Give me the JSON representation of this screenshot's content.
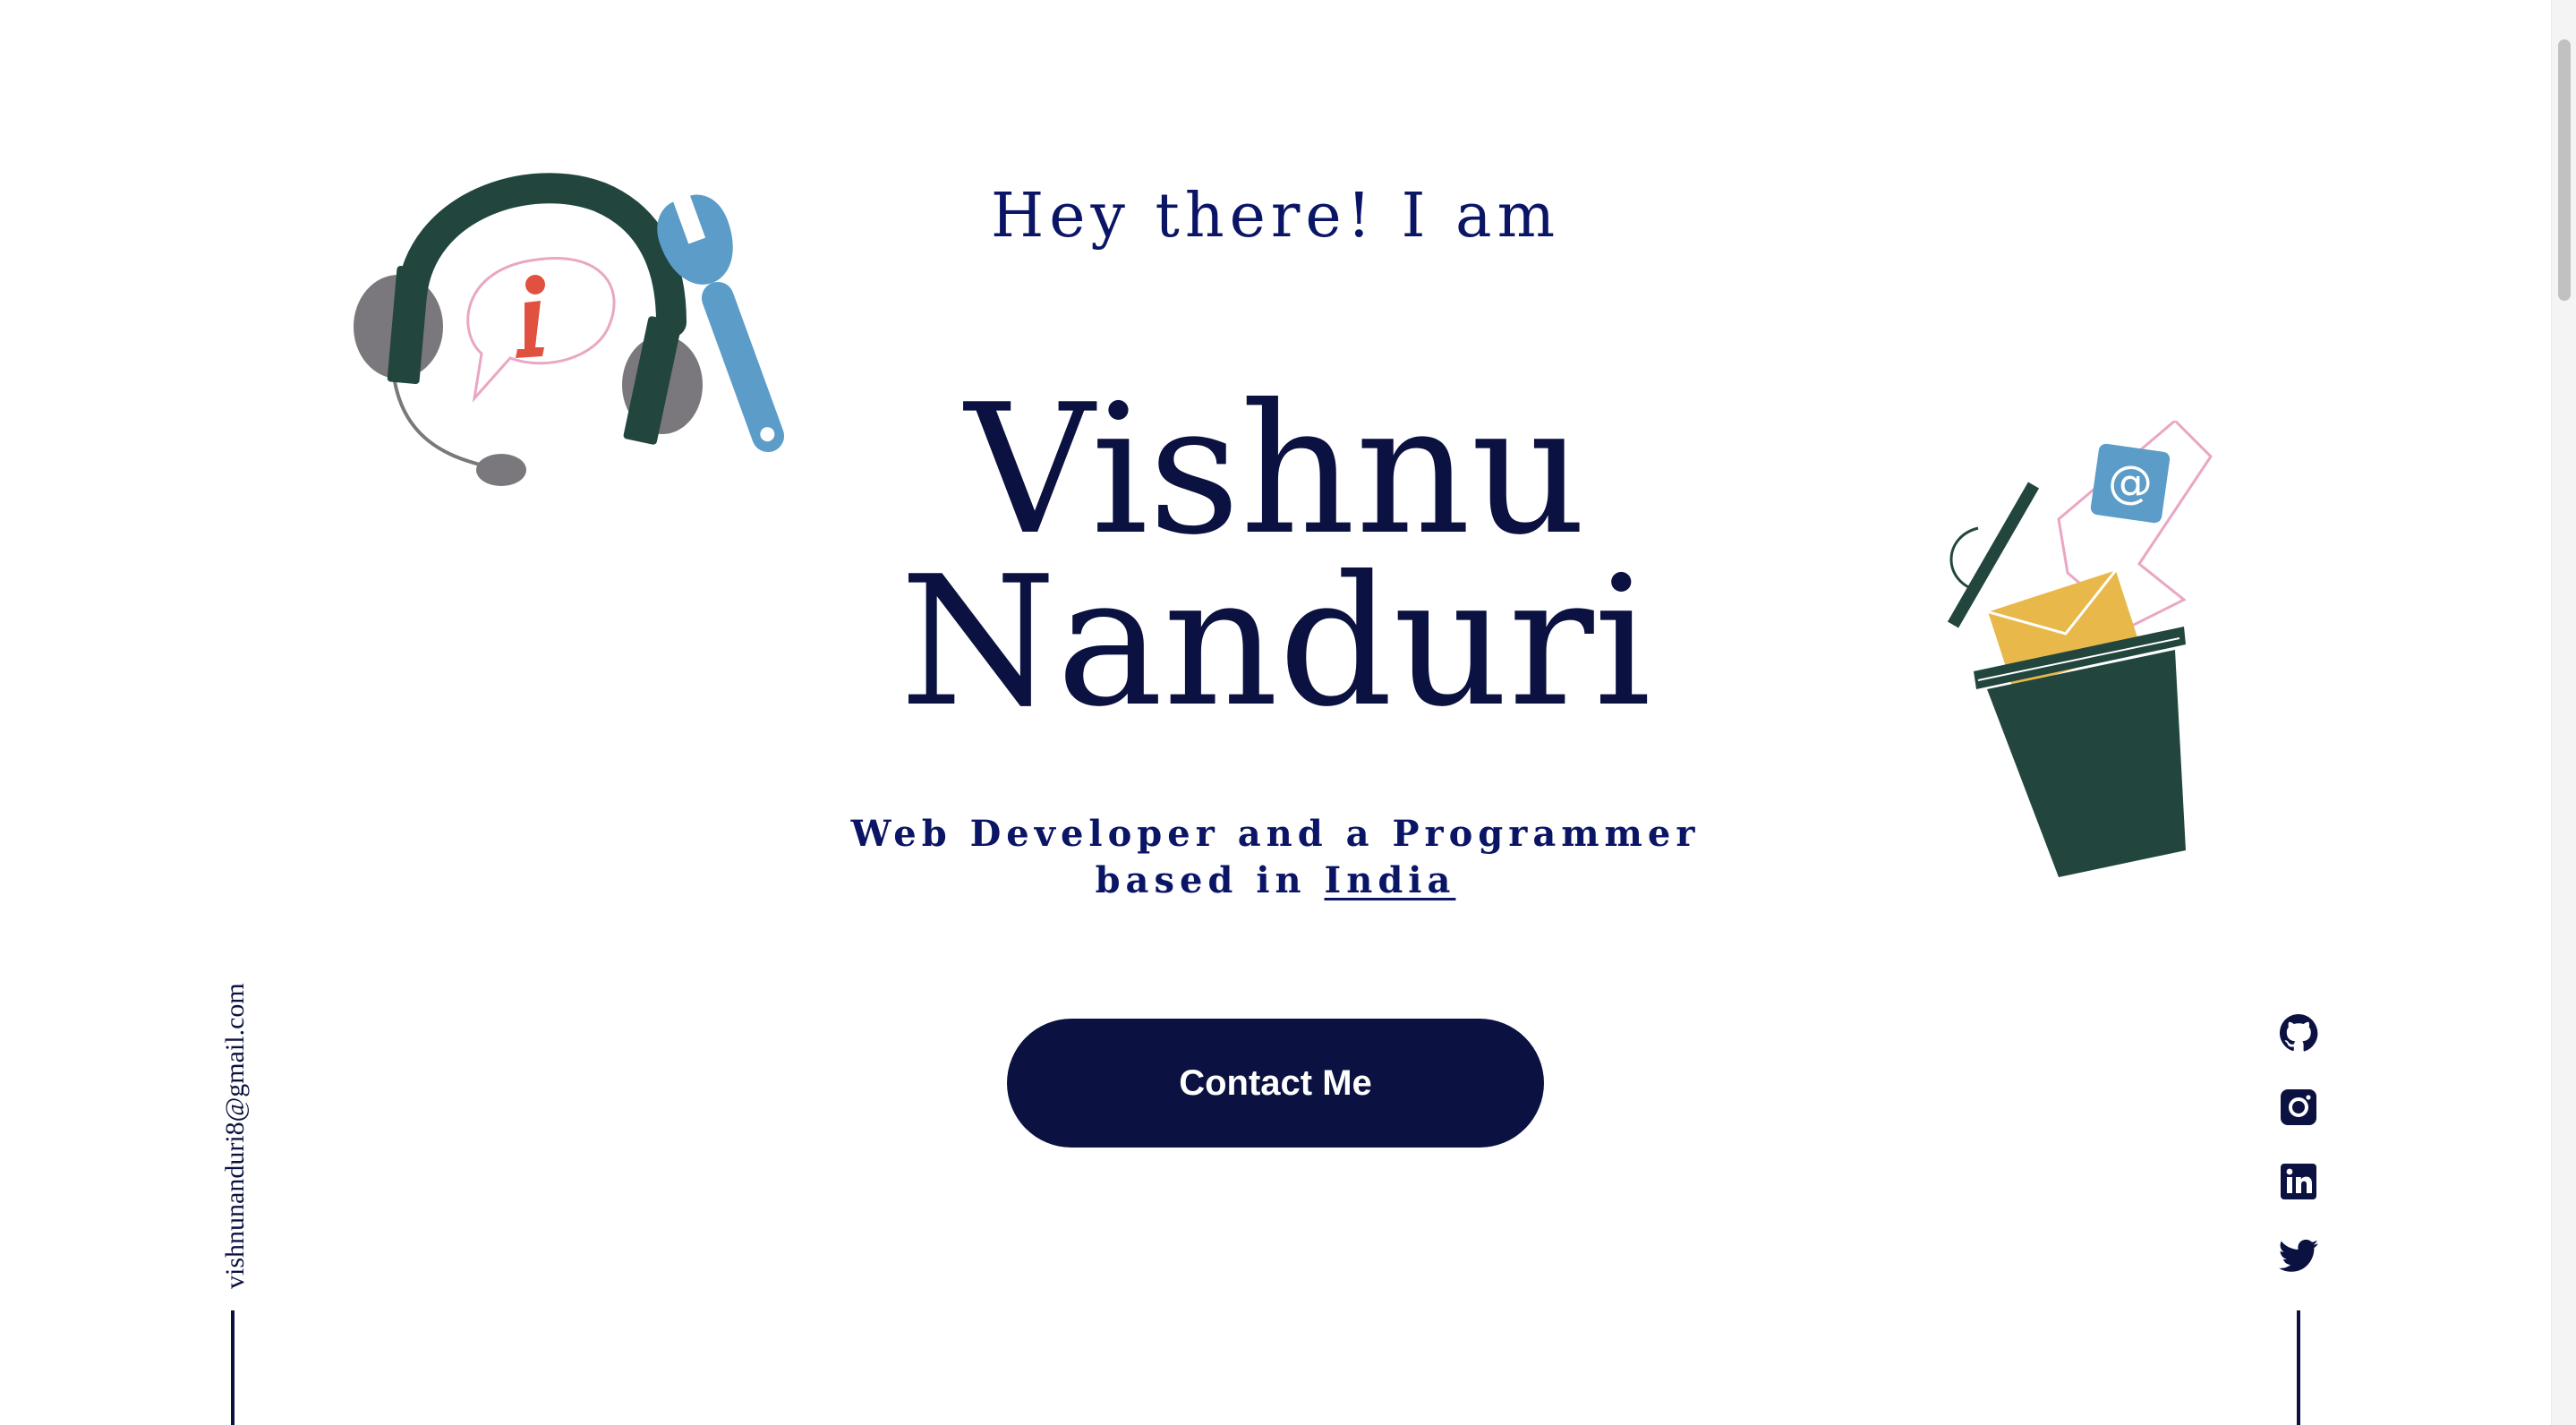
{
  "hero": {
    "greeting": "Hey there! I am",
    "first_name": "Vishnu",
    "last_name": "Nanduri",
    "tagline_line1": "Web Developer and a Programmer",
    "tagline_prefix": "based in ",
    "tagline_country": "India",
    "contact_label": "Contact Me"
  },
  "sidebar_left": {
    "email": "vishnunanduri8@gmail.com"
  },
  "social_links": [
    {
      "name": "github",
      "icon": "github-icon"
    },
    {
      "name": "instagram",
      "icon": "instagram-icon"
    },
    {
      "name": "linkedin",
      "icon": "linkedin-icon"
    },
    {
      "name": "twitter",
      "icon": "twitter-icon"
    }
  ],
  "illustrations": {
    "left": "headphones-wrench-illustration",
    "right": "mail-trash-illustration"
  },
  "colors": {
    "primary": "#0b1140",
    "accent_text": "#0b1566",
    "background": "#ffffff",
    "dark_green": "#22463e",
    "blue": "#5b9cc8",
    "yellow": "#e8b84a",
    "pink": "#eaa6c3",
    "red": "#e0513f",
    "gray": "#7a787c"
  }
}
